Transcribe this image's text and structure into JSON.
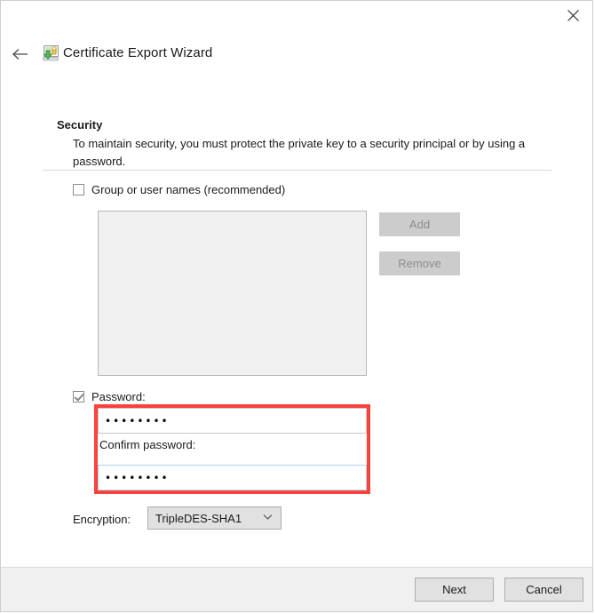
{
  "window": {
    "title": "Certificate Export Wizard",
    "close_label": "✕",
    "back_label": "←",
    "icon_name": "certificate-export-icon"
  },
  "page": {
    "heading": "Security",
    "description": "To maintain security, you must protect the private key to a security principal or by using a password."
  },
  "group_section": {
    "checkbox_label": "Group or user names (recommended)",
    "checked": false,
    "list_items": [],
    "add_label": "Add",
    "remove_label": "Remove",
    "buttons_disabled": true
  },
  "password_section": {
    "checkbox_label": "Password:",
    "checked": true,
    "password_value": "••••••••",
    "confirm_label": "Confirm password:",
    "confirm_value": "••••••••"
  },
  "encryption": {
    "label": "Encryption:",
    "selected": "TripleDES-SHA1",
    "caret": "⌄"
  },
  "footer": {
    "next_label": "Next",
    "cancel_label": "Cancel"
  },
  "colors": {
    "highlight": "#f9423a",
    "footer_bg": "#f0f0f0",
    "button_bg": "#e1e1e1"
  }
}
